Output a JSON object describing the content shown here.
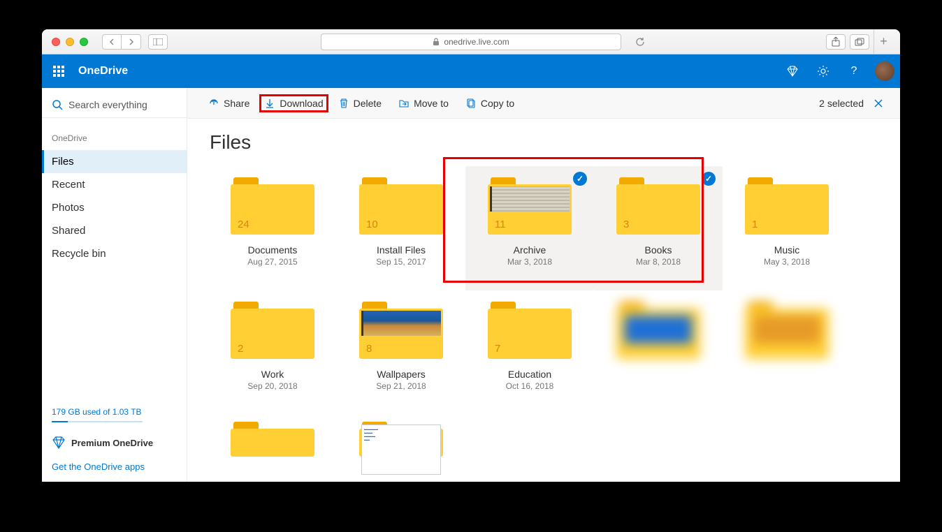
{
  "browser": {
    "url": "onedrive.live.com"
  },
  "header": {
    "appName": "OneDrive"
  },
  "search": {
    "placeholder": "Search everything"
  },
  "breadcrumb": "OneDrive",
  "nav": {
    "items": [
      {
        "label": "Files",
        "active": true
      },
      {
        "label": "Recent",
        "active": false
      },
      {
        "label": "Photos",
        "active": false
      },
      {
        "label": "Shared",
        "active": false
      },
      {
        "label": "Recycle bin",
        "active": false
      }
    ]
  },
  "storage": {
    "text": "179 GB used of 1.03 TB"
  },
  "premium": {
    "label": "Premium OneDrive"
  },
  "apps": {
    "label": "Get the OneDrive apps"
  },
  "cmdbar": {
    "share": "Share",
    "download": "Download",
    "delete": "Delete",
    "moveto": "Move to",
    "copyto": "Copy to",
    "selected": "2 selected"
  },
  "page": {
    "title": "Files"
  },
  "folders": [
    {
      "name": "Documents",
      "date": "Aug 27, 2015",
      "count": "24",
      "selected": false,
      "thumb": null
    },
    {
      "name": "Install Files",
      "date": "Sep 15, 2017",
      "count": "10",
      "selected": false,
      "thumb": null
    },
    {
      "name": "Archive",
      "date": "Mar 3, 2018",
      "count": "11",
      "selected": true,
      "thumb": "paperstack"
    },
    {
      "name": "Books",
      "date": "Mar 8, 2018",
      "count": "3",
      "selected": true,
      "thumb": null
    },
    {
      "name": "Music",
      "date": "May 3, 2018",
      "count": "1",
      "selected": false,
      "thumb": null
    },
    {
      "name": "Work",
      "date": "Sep 20, 2018",
      "count": "2",
      "selected": false,
      "thumb": null
    },
    {
      "name": "Wallpapers",
      "date": "Sep 21, 2018",
      "count": "8",
      "selected": false,
      "thumb": "ocean"
    },
    {
      "name": "Education",
      "date": "Oct 16, 2018",
      "count": "7",
      "selected": false,
      "thumb": null
    },
    {
      "name": "",
      "date": "",
      "count": "",
      "selected": false,
      "thumb": null,
      "blurred": true
    },
    {
      "name": "",
      "date": "",
      "count": "",
      "selected": false,
      "thumb": null,
      "blurred": true
    },
    {
      "name": "",
      "date": "",
      "count": "",
      "selected": false,
      "thumb": null,
      "partial": true
    },
    {
      "name": "",
      "date": "",
      "count": "",
      "selected": false,
      "thumb": "paper",
      "partial": true
    }
  ]
}
